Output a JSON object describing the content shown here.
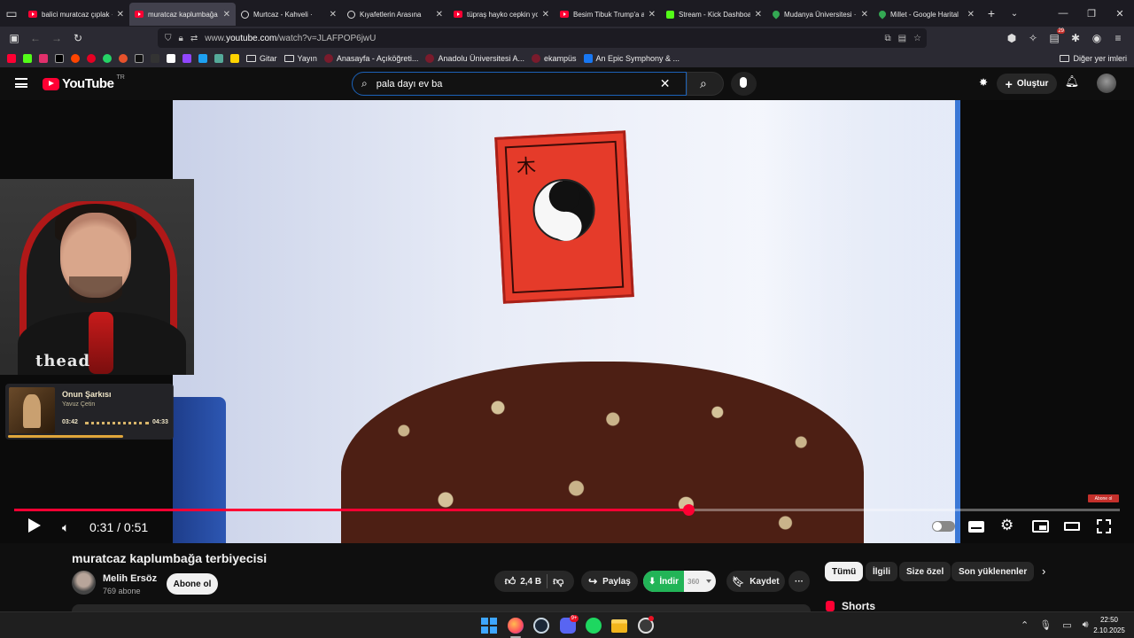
{
  "browser": {
    "tabs": [
      {
        "title": "balici muratcaz çıplak ·",
        "icon": "youtube-icon",
        "active": false
      },
      {
        "title": "muratcaz kaplumbağa",
        "icon": "youtube-icon",
        "active": true
      },
      {
        "title": "Murtcaz - Kahveli ·",
        "icon": "circle-icon",
        "active": false
      },
      {
        "title": "Kıyafetlerin Arasına",
        "icon": "circle-icon",
        "active": false
      },
      {
        "title": "tüpraş hayko cepkin yo",
        "icon": "youtube-icon",
        "active": false
      },
      {
        "title": "Besim Tibuk Trump'a a",
        "icon": "youtube-icon",
        "active": false
      },
      {
        "title": "Stream - Kick Dashboa",
        "icon": "kick-icon",
        "active": false
      },
      {
        "title": "Mudanya Üniversitesi ·",
        "icon": "maps-pin-icon",
        "active": false
      },
      {
        "title": "Millet - Google Harital",
        "icon": "maps-pin-icon",
        "active": false
      }
    ],
    "url_prefix": "www.",
    "url_host": "youtube.com",
    "url_path": "/watch?v=JLAFPOP6jwU",
    "bookmarks": [
      {
        "label": "Gitar",
        "type": "folder"
      },
      {
        "label": "Yayın",
        "type": "folder"
      },
      {
        "label": "Anasayfa - Açıköğreti...",
        "type": "link",
        "color": "#7a1b2c"
      },
      {
        "label": "Anadolu Üniversitesi A...",
        "type": "link",
        "color": "#7a1b2c"
      },
      {
        "label": "ekampüs",
        "type": "link",
        "color": "#7a1b2c"
      },
      {
        "label": "An Epic Symphony & ...",
        "type": "link",
        "color": "#1877f2"
      }
    ],
    "other_bookmarks": "Diğer yer imleri",
    "extension_badge": "29"
  },
  "youtube": {
    "logo_text": "YouTube",
    "country_code": "TR",
    "search_value": "pala dayı ev ba",
    "create_label": "Oluştur"
  },
  "player": {
    "time_current": "0:31",
    "time_separator": "/",
    "time_total": "0:51",
    "progress_fraction": 0.61,
    "subscribe_badge": "Abone ol"
  },
  "overlay": {
    "shirt_text": "thead",
    "song_title": "Onun Şarkısı",
    "song_artist": "Yavuz Çetin",
    "song_elapsed": "03:42",
    "song_total": "04:33",
    "song_progress_fraction": 0.81
  },
  "video_info": {
    "title": "muratcaz kaplumbağa terbiyecisi",
    "channel_name": "Melih Ersöz",
    "channel_subs": "769 abone",
    "subscribe_label": "Abone ol",
    "like_count": "2,4 B",
    "share_label": "Paylaş",
    "download_label": "İndir",
    "download_res": "360",
    "save_label": "Kaydet"
  },
  "chips": [
    "Tümü",
    "İlgili",
    "Size özel",
    "Son yüklenenler"
  ],
  "shorts_label": "Shorts",
  "taskbar": {
    "discord_badge": "9+",
    "time": "22:50",
    "date": "2.10.2025"
  },
  "colors": {
    "accent_red": "#ff0033",
    "download_green": "#22b457",
    "search_border": "#1c62b9"
  }
}
